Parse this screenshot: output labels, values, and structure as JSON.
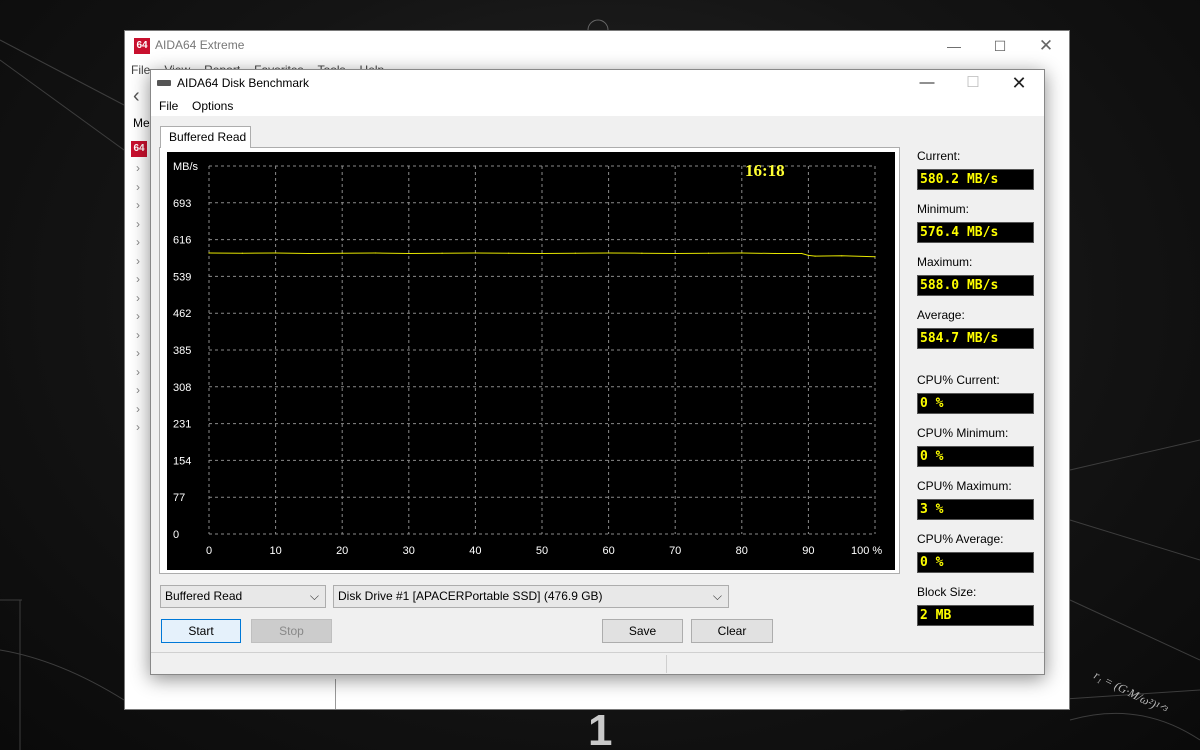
{
  "desktop": {
    "number": "1",
    "formula": "r₁ = (G·M/ω²)¹ᐟ³"
  },
  "main_window": {
    "icon_text": "64",
    "title": "AIDA64 Extreme",
    "menu": [
      "File",
      "View",
      "Report",
      "Favorites",
      "Tools",
      "Help"
    ],
    "sidebar_label": "Me",
    "tree_arrow_count": 15
  },
  "bench_window": {
    "title": "AIDA64 Disk Benchmark",
    "menu": [
      "File",
      "Options"
    ],
    "tab_label": "Buffered Read",
    "stats": [
      {
        "label": "Current:",
        "value": "580.2 MB/s"
      },
      {
        "label": "Minimum:",
        "value": "576.4 MB/s"
      },
      {
        "label": "Maximum:",
        "value": "588.0 MB/s"
      },
      {
        "label": "Average:",
        "value": "584.7 MB/s"
      },
      {
        "label": "CPU% Current:",
        "value": "0 %"
      },
      {
        "label": "CPU% Minimum:",
        "value": "0 %"
      },
      {
        "label": "CPU% Maximum:",
        "value": "3 %"
      },
      {
        "label": "CPU% Average:",
        "value": "0 %"
      },
      {
        "label": "Block Size:",
        "value": "2 MB"
      }
    ],
    "test_select": "Buffered Read",
    "drive_select": "Disk Drive #1  [APACERPortable SSD]  (476.9 GB)",
    "buttons": {
      "start": "Start",
      "stop": "Stop",
      "save": "Save",
      "clear": "Clear"
    }
  },
  "chart_data": {
    "type": "line",
    "ylabel": "MB/s",
    "time_label": "16:18",
    "y_ticks": [
      0,
      77,
      154,
      231,
      308,
      385,
      462,
      539,
      616,
      693
    ],
    "x_ticks": [
      "0",
      "10",
      "20",
      "30",
      "40",
      "50",
      "60",
      "70",
      "80",
      "90",
      "100 %"
    ],
    "xlim": [
      0,
      100
    ],
    "ylim": [
      0,
      770
    ],
    "grid": true,
    "colors": {
      "background": "#000000",
      "grid": "#8a8a8a",
      "line": "#e6e600",
      "label": "#ffffff",
      "time": "#ffff33"
    },
    "series": [
      {
        "x": [
          0,
          5,
          10,
          15,
          20,
          25,
          30,
          35,
          40,
          45,
          50,
          55,
          60,
          65,
          70,
          75,
          80,
          85,
          89,
          90,
          91,
          95,
          100
        ],
        "values": [
          588,
          587.5,
          588,
          587,
          587.5,
          588,
          587,
          587.5,
          588,
          587.5,
          587,
          587.5,
          588,
          587.5,
          587,
          587.5,
          588,
          587,
          587,
          583,
          581.5,
          582,
          580.2
        ]
      }
    ]
  }
}
